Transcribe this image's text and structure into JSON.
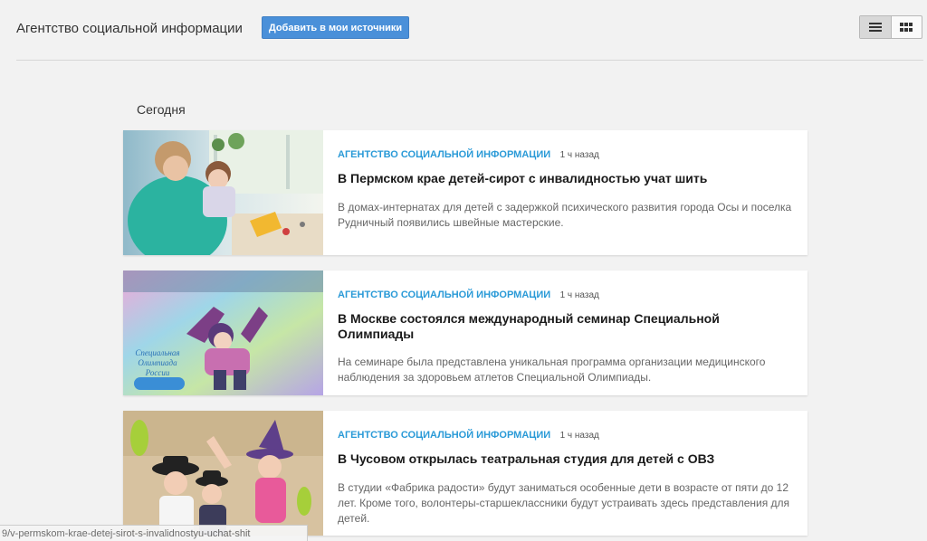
{
  "header": {
    "source_title": "Агентство социальной информации",
    "add_button": "Добавить в мои источники"
  },
  "view_toggle": {
    "list_icon": "list-icon",
    "grid_icon": "grid-icon"
  },
  "section": {
    "label": "Сегодня"
  },
  "colors": {
    "accent": "#2a9ad7",
    "button": "#4a90d9"
  },
  "articles": [
    {
      "source": "Агентство социальной информации",
      "time": "1 ч назад",
      "title": "В Пермском крае детей-сирот с инвалидностью учат шить",
      "snippet": "В домах-интернатах для детей с задержкой психического развития города Осы и поселка Рудничный появились швейные мастерские."
    },
    {
      "source": "Агентство социальной информации",
      "time": "1 ч назад",
      "title": "В Москве состоялся международный семинар Специальной Олимпиады",
      "snippet": "На семинаре была представлена уникальная программа организации медицинского наблюдения за здоровьем атлетов Специальной Олимпиады.",
      "image_text": "Специальная Олимпиада России"
    },
    {
      "source": "Агентство социальной информации",
      "time": "1 ч назад",
      "title": "В Чусовом открылась театральная студия для детей с ОВЗ",
      "snippet": "В студии «Фабрика радости» будут заниматься особенные дети в возрасте от пяти до 12 лет. Кроме того, волонтеры-старшеклассники будут устраивать здесь представления для детей."
    }
  ],
  "status_url": "9/v-permskom-krae-detej-sirot-s-invalidnostyu-uchat-shit"
}
